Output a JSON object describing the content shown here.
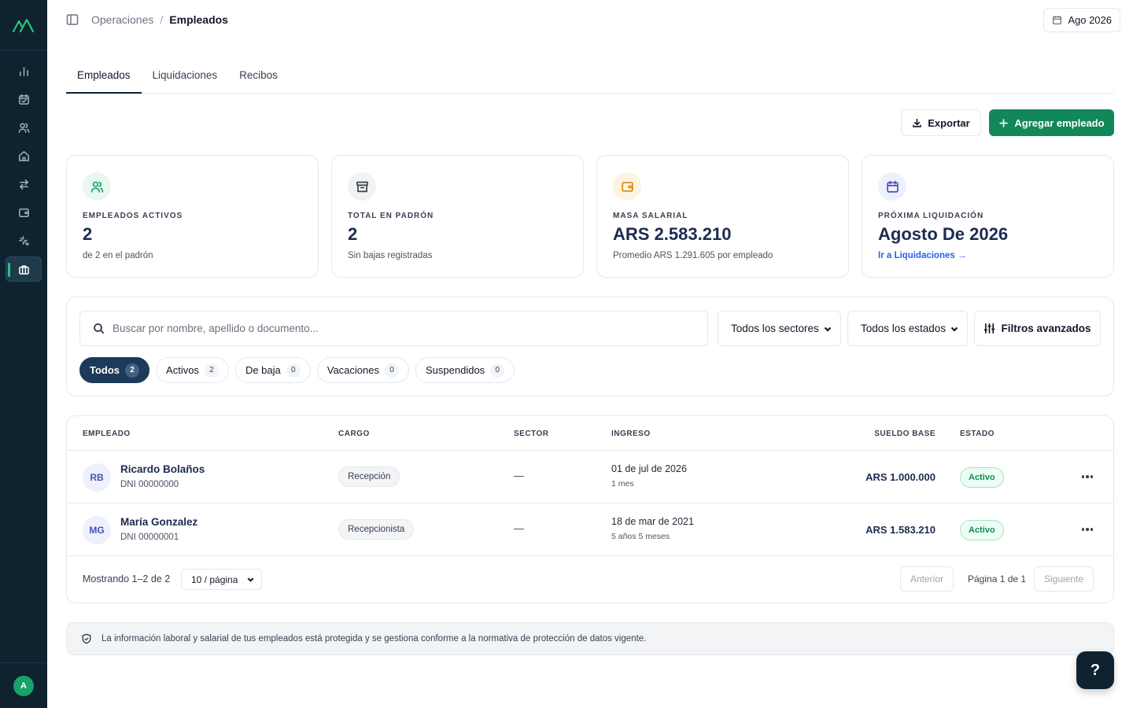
{
  "colors": {
    "sidebar": "#0f2230",
    "accent_green": "#12885a",
    "navy_text": "#1e2b50",
    "link_blue": "#2563eb"
  },
  "sidebar": {
    "items": [
      {
        "icon": "bar-chart-icon"
      },
      {
        "icon": "calendar-check-icon"
      },
      {
        "icon": "users-icon"
      },
      {
        "icon": "home-icon"
      },
      {
        "icon": "arrows-exchange-icon"
      },
      {
        "icon": "wallet-icon"
      },
      {
        "icon": "sparkles-icon"
      },
      {
        "icon": "briefcase-icon",
        "active": true
      }
    ],
    "avatar_initial": "A"
  },
  "header": {
    "breadcrumb_parent": "Operaciones",
    "breadcrumb_separator": "/",
    "breadcrumb_current": "Empleados",
    "period": "Ago 2026"
  },
  "tabs": [
    {
      "label": "Empleados",
      "active": true
    },
    {
      "label": "Liquidaciones"
    },
    {
      "label": "Recibos"
    }
  ],
  "actions": {
    "export_label": "Exportar",
    "add_label": "Agregar empleado"
  },
  "stats": [
    {
      "label": "EMPLEADOS ACTIVOS",
      "value": "2",
      "sub": "de 2 en el padrón",
      "icon": "users-icon"
    },
    {
      "label": "TOTAL EN PADRÓN",
      "value": "2",
      "sub": "Sin bajas registradas",
      "icon": "archive-icon"
    },
    {
      "label": "MASA SALARIAL",
      "value": "ARS 2.583.210",
      "sub": "Promedio ARS 1.291.605 por empleado",
      "icon": "wallet-icon"
    },
    {
      "label": "PRÓXIMA LIQUIDACIÓN",
      "value": "Agosto De 2026",
      "link": "Ir a Liquidaciones →",
      "icon": "calendar-icon"
    }
  ],
  "filters": {
    "search_placeholder": "Buscar por nombre, apellido o documento...",
    "search_value": "",
    "sector_select": "Todos los sectores",
    "status_select": "Todos los estados",
    "advanced_label": "Filtros avanzados",
    "chips": [
      {
        "label": "Todos",
        "count": "2",
        "active": true
      },
      {
        "label": "Activos",
        "count": "2"
      },
      {
        "label": "De baja",
        "count": "0"
      },
      {
        "label": "Vacaciones",
        "count": "0"
      },
      {
        "label": "Suspendidos",
        "count": "0"
      }
    ]
  },
  "table": {
    "columns": {
      "employee": "EMPLEADO",
      "role": "CARGO",
      "sector": "SECTOR",
      "start": "INGRESO",
      "salary": "SUELDO BASE",
      "status": "ESTADO"
    },
    "rows": [
      {
        "initials": "RB",
        "name": "Ricardo Bolaños",
        "doc": "DNI 00000000",
        "role": "Recepción",
        "sector": "—",
        "start_date": "01 de jul de 2026",
        "tenure": "1 mes",
        "salary": "ARS 1.000.000",
        "status": "Activo"
      },
      {
        "initials": "MG",
        "name": "María Gonzalez",
        "doc": "DNI 00000001",
        "role": "Recepcionista",
        "sector": "—",
        "start_date": "18 de mar de 2021",
        "tenure": "5 años 5 meses",
        "salary": "ARS 1.583.210",
        "status": "Activo"
      }
    ],
    "footer": {
      "showing": "Mostrando 1–2 de 2",
      "per_page": "10 / página",
      "prev": "Anterior",
      "page_info": "Página 1 de 1",
      "next": "Siguiente"
    }
  },
  "notice": "La información laboral y salarial de tus empleados está protegida y se gestiona conforme a la normativa de protección de datos vigente.",
  "help_label": "?"
}
